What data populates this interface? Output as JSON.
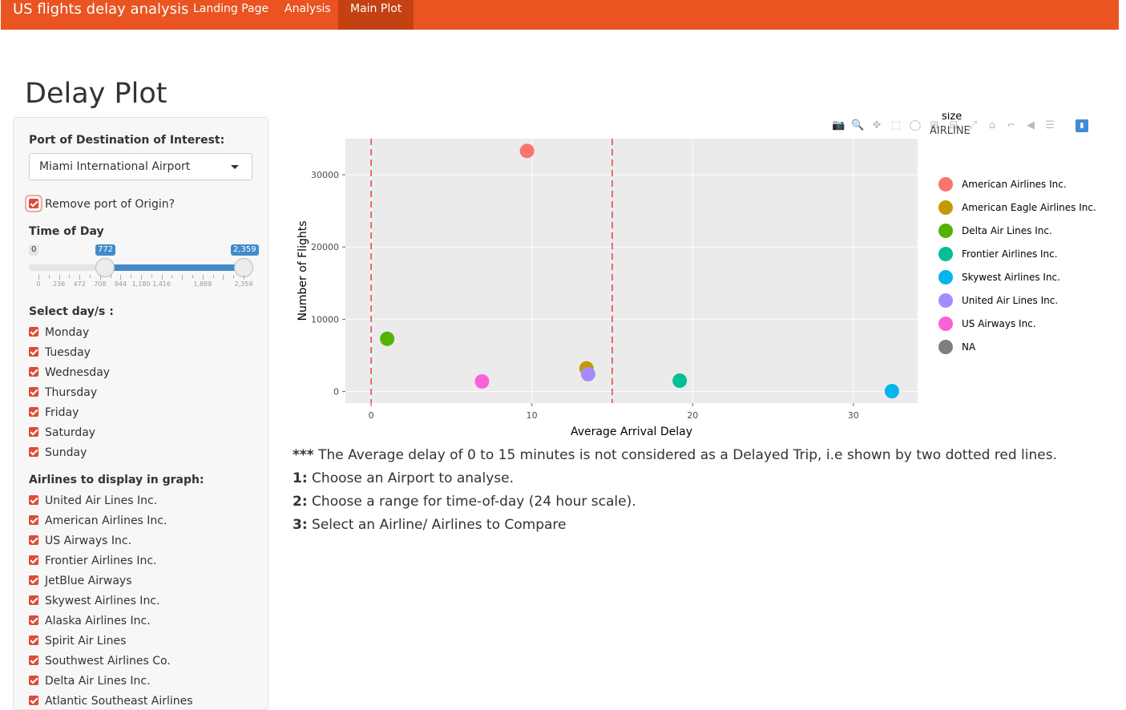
{
  "nav": {
    "brand": "US flights delay analysis",
    "links": [
      {
        "label": "Landing Page"
      },
      {
        "label": "Analysis"
      },
      {
        "label": "Main Plot"
      }
    ]
  },
  "page": {
    "title": "Delay Plot"
  },
  "sidebar": {
    "port_label": "Port of Destination of Interest:",
    "port_value": "Miami International Airport",
    "remove_origin_label": "Remove port of Origin?",
    "time_label": "Time of Day",
    "slider": {
      "min_tag": "0",
      "from_tag": "772",
      "to_tag": "2,359",
      "from_value": 772,
      "to_value": 2359,
      "min": 0,
      "max": 2359,
      "tick_labels": [
        "0",
        "236",
        "472",
        "708",
        "944",
        "1,180",
        "1,416",
        "1,888",
        "2,359"
      ]
    },
    "days_label": "Select day/s :",
    "days": [
      "Monday",
      "Tuesday",
      "Wednesday",
      "Thursday",
      "Friday",
      "Saturday",
      "Sunday"
    ],
    "airlines_label": "Airlines to display in graph:",
    "airlines": [
      "United Air Lines Inc.",
      "American Airlines Inc.",
      "US Airways Inc.",
      "Frontier Airlines Inc.",
      "JetBlue Airways",
      "Skywest Airlines Inc.",
      "Alaska Airlines Inc.",
      "Spirit Air Lines",
      "Southwest Airlines Co.",
      "Delta Air Lines Inc.",
      "Atlantic Southeast Airlines"
    ]
  },
  "modebar": {
    "icons": [
      "camera-icon",
      "zoom-icon",
      "pan-icon",
      "box-select-icon",
      "lasso-icon",
      "zoom-in-icon",
      "zoom-out-icon",
      "autoscale-icon",
      "reset-axes-icon",
      "spike-lines-icon",
      "hover-closest-icon",
      "hover-compare-icon",
      "plotly-logo-icon"
    ]
  },
  "chart_data": {
    "type": "scatter",
    "xlabel": "Average Arrival Delay",
    "ylabel": "Number of Flights",
    "xlim": [
      -1.6,
      34
    ],
    "ylim": [
      -1600,
      35000
    ],
    "xticks": [
      0,
      10,
      20,
      30
    ],
    "yticks": [
      0,
      10000,
      20000,
      30000
    ],
    "xtick_labels": [
      "0",
      "10",
      "20",
      "30"
    ],
    "ytick_labels": [
      "0",
      "10000",
      "20000",
      "30000"
    ],
    "vlines": [
      0,
      15
    ],
    "legend_title_top": "size",
    "legend_title": "AIRLINE",
    "legend_position": "right",
    "grid": true,
    "series": [
      {
        "name": "American Airlines Inc.",
        "color": "#f8766d",
        "x": 9.7,
        "y": 33300
      },
      {
        "name": "American Eagle Airlines Inc.",
        "color": "#c49a00",
        "x": 13.4,
        "y": 3200
      },
      {
        "name": "Delta Air Lines Inc.",
        "color": "#53b400",
        "x": 1.0,
        "y": 7300
      },
      {
        "name": "Frontier Airlines Inc.",
        "color": "#00c094",
        "x": 19.2,
        "y": 1500
      },
      {
        "name": "Skywest Airlines Inc.",
        "color": "#00b6eb",
        "x": 32.4,
        "y": 50
      },
      {
        "name": "United Air Lines Inc.",
        "color": "#a58aff",
        "x": 13.5,
        "y": 2400
      },
      {
        "name": "US Airways Inc.",
        "color": "#fb61d7",
        "x": 6.9,
        "y": 1400
      },
      {
        "name": "NA",
        "color": "#7f7f7f",
        "x": null,
        "y": null
      }
    ]
  },
  "notes": {
    "line1_prefix": "***",
    "line1": " The Average delay of 0 to 15 minutes is not considered as a Delayed Trip, i.e shown by two dotted red lines.",
    "line2_prefix": "1:",
    "line2": " Choose an Airport to analyse.",
    "line3_prefix": "2:",
    "line3": " Choose a range for time-of-day (24 hour scale).",
    "line4_prefix": "3:",
    "line4": " Select an Airline/ Airlines to Compare"
  }
}
